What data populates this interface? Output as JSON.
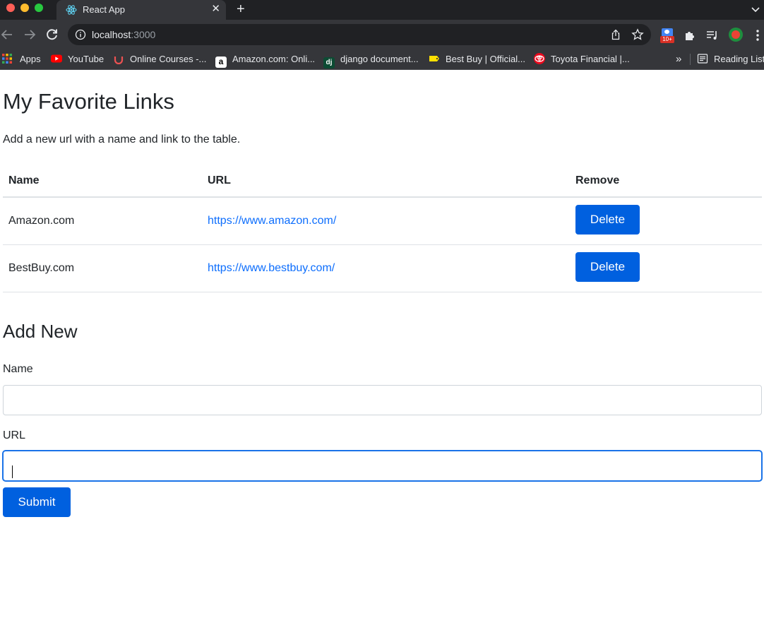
{
  "browser": {
    "tab_title": "React App",
    "tab_close": "✕",
    "new_tab": "+",
    "url_host": "localhost",
    "url_port": ":3000",
    "extension_badge": "10+",
    "bookmarks": [
      {
        "label": "Apps",
        "color": "#ea4335"
      },
      {
        "label": "YouTube",
        "color": "#ff0000"
      },
      {
        "label": "Online Courses -...",
        "color": "#a435f0"
      },
      {
        "label": "Amazon.com: Onli...",
        "color": "#ffffff"
      },
      {
        "label": "django document...",
        "color": "#0c4b33"
      },
      {
        "label": "Best Buy | Official...",
        "color": "#ffe000"
      },
      {
        "label": "Toyota Financial |...",
        "color": "#eb0a1e"
      }
    ],
    "bookmarks_overflow": "»",
    "reading_list": "Reading List",
    "django_icon_text": "dj",
    "amazon_icon_text": "a"
  },
  "page": {
    "title": "My Favorite Links",
    "subtitle": "Add a new url with a name and link to the table.",
    "table": {
      "headers": [
        "Name",
        "URL",
        "Remove"
      ],
      "rows": [
        {
          "name": "Amazon.com",
          "url": "https://www.amazon.com/",
          "action": "Delete"
        },
        {
          "name": "BestBuy.com",
          "url": "https://www.bestbuy.com/",
          "action": "Delete"
        }
      ]
    },
    "form": {
      "title": "Add New",
      "name_label": "Name",
      "name_value": "",
      "url_label": "URL",
      "url_value": "",
      "submit_label": "Submit"
    }
  },
  "colors": {
    "primary": "#0060df",
    "link": "#0d6efd",
    "focus": "#1a73e8"
  }
}
